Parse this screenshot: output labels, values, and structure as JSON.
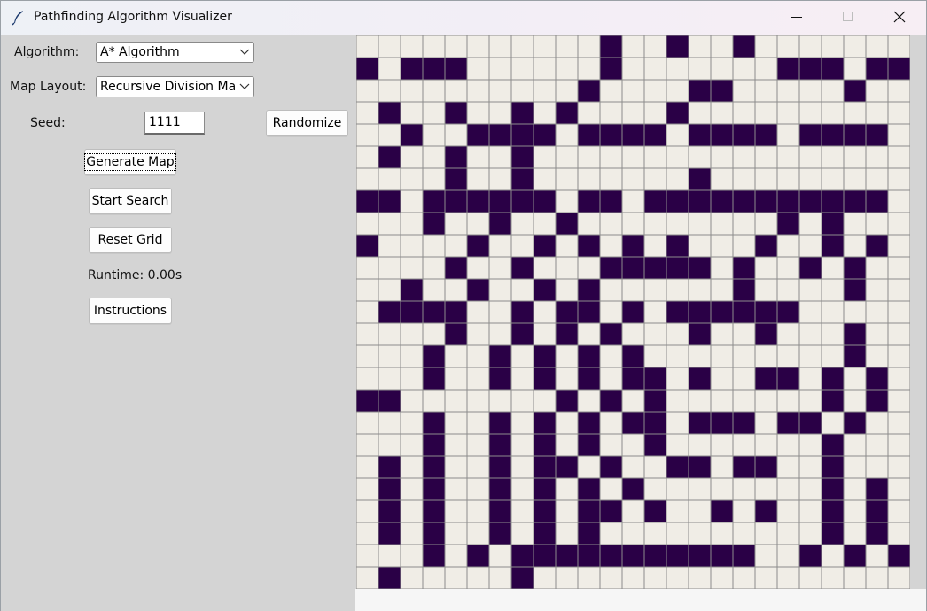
{
  "window": {
    "title": "Pathfinding Algorithm Visualizer"
  },
  "icons": {
    "app": "feather-icon",
    "minimize": "minimize-icon",
    "maximize": "maximize-icon",
    "close": "close-icon",
    "dropdown": "chevron-down-icon"
  },
  "controls": {
    "algorithm_label": "Algorithm:",
    "algorithm_value": "A* Algorithm",
    "map_layout_label": "Map Layout:",
    "map_layout_value": "Recursive Division Maz",
    "seed_label": "Seed:",
    "seed_value": "1111",
    "randomize_label": "Randomize",
    "generate_label": "Generate Map",
    "start_label": "Start Search",
    "reset_label": "Reset Grid",
    "runtime_text": "Runtime: 0.00s",
    "instructions_label": "Instructions"
  },
  "colors": {
    "wall": "#2a0046",
    "empty": "#f0ede6",
    "gridline": "#8c8c8c"
  },
  "grid": {
    "rows": 25,
    "cols": 25,
    "cells": [
      "...........#..#..#.......",
      "#.###......#.......###.###",
      "..........#....##.....#..",
      ".#..#..#.#....#..........",
      "..#..####.####.####.####.",
      ".#..#..#.................",
      "....#..#.......#.........",
      "##.######.##.###########",
      "...#..#..#.........#.#..",
      "#....#..#.#.#.#...#..#.#.",
      "....#..#...#####.#..#.#..",
      "..#..#..#.#......#....#..",
      ".####..#.##.#.######.....",
      "....#..#.#.#...#..#...#..",
      "...#..#.#.#.#.........#..",
      "...#..#.#.#.##.#..##.#.#.",
      "##.......#.#.#.......#.#.",
      "...#..#.#.#.##.###.##.#..",
      "...#..#.#.#..#.......#...",
      ".#.#..#.##.#..##.##..#...",
      ".#.#..#.#.#.#........#.#.",
      ".#.#..#.#.##.#..#.#..#.#.",
      ".#.#..#.#.#..........#.#.",
      "...#.#.###########..#.#.#",
      ".#.....#................."
    ]
  }
}
